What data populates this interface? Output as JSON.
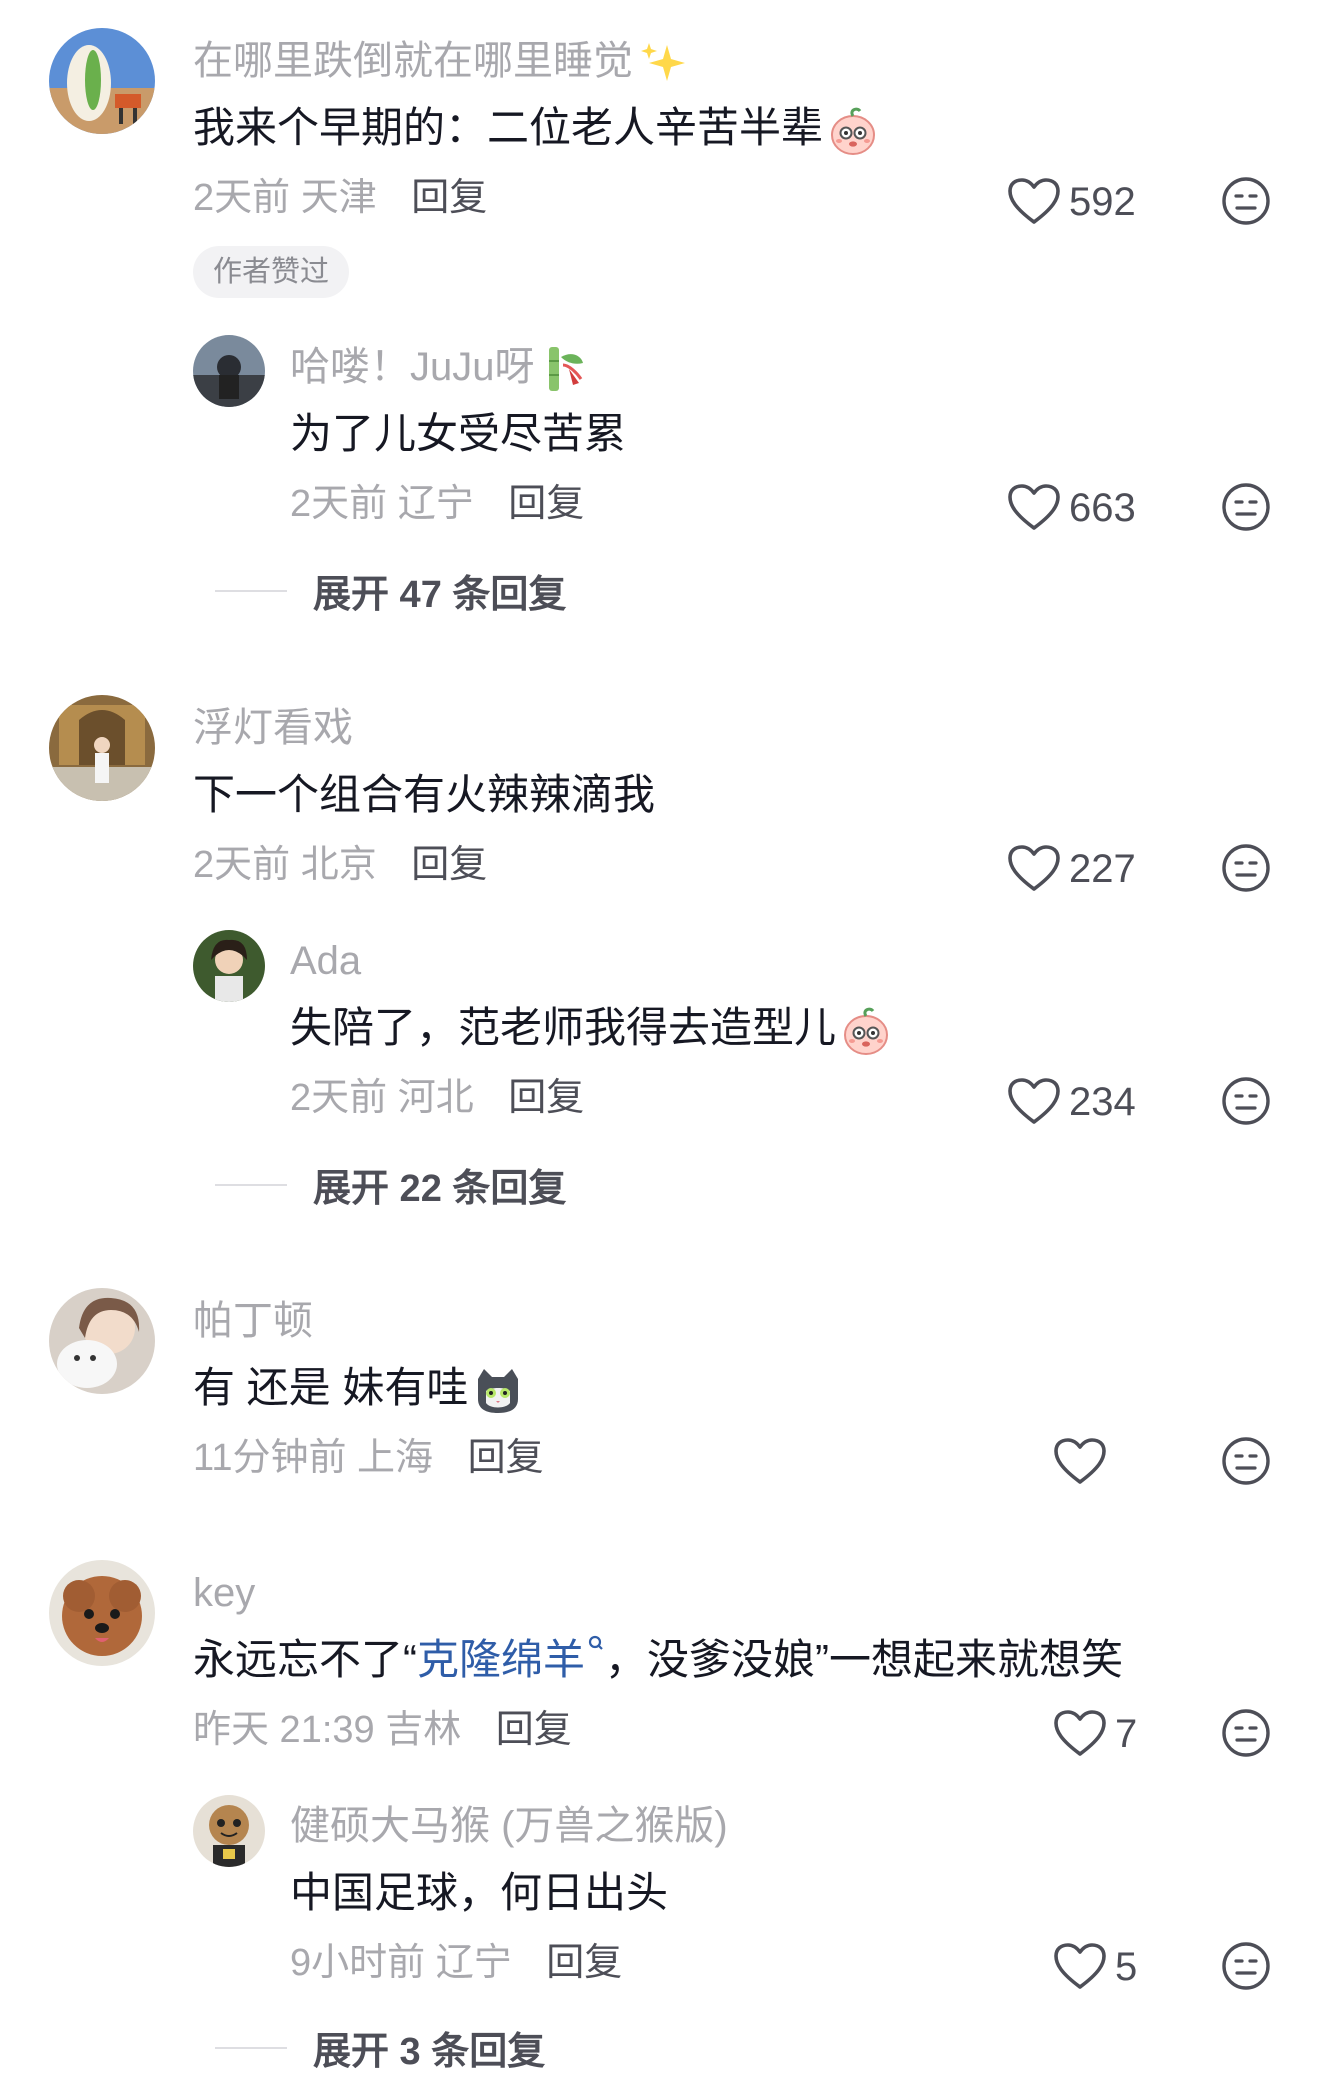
{
  "comments": [
    {
      "username": "在哪里跌倒就在哪里睡觉",
      "text": "我来个早期的：二位老人辛苦半辈",
      "time": "2天前",
      "location": "天津",
      "reply_label": "回复",
      "likes": "592",
      "badge": "作者赞过",
      "replies": [
        {
          "username": "哈喽！JuJu呀",
          "text": "为了儿女受尽苦累",
          "time": "2天前",
          "location": "辽宁",
          "reply_label": "回复",
          "likes": "663"
        }
      ],
      "expand_label": "展开 47 条回复"
    },
    {
      "username": "浮灯看戏",
      "text": "下一个组合有火辣辣滴我",
      "time": "2天前",
      "location": "北京",
      "reply_label": "回复",
      "likes": "227",
      "replies": [
        {
          "username": "Ada",
          "text": "失陪了，范老师我得去造型儿",
          "time": "2天前",
          "location": "河北",
          "reply_label": "回复",
          "likes": "234"
        }
      ],
      "expand_label": "展开 22 条回复"
    },
    {
      "username": "帕丁顿",
      "text": "有 还是 妹有哇",
      "time": "11分钟前",
      "location": "上海",
      "reply_label": "回复",
      "likes": ""
    },
    {
      "username": "key",
      "text_before": "永远忘不了“",
      "text_link": "克隆绵羊",
      "text_after": "，没爹没娘”一想起来就想笑",
      "time": "昨天 21:39",
      "location": "吉林",
      "reply_label": "回复",
      "likes": "7",
      "replies": [
        {
          "username": "健硕大马猴 (万兽之猴版)",
          "text": "中国足球，何日出头",
          "time": "9小时前",
          "location": "辽宁",
          "reply_label": "回复",
          "likes": "5"
        }
      ],
      "expand_label": "展开 3 条回复"
    }
  ],
  "icons": {
    "like": "heart-outline-icon",
    "dislike": "meh-face-icon",
    "sparkle": "sparkles-emoji",
    "peach_face": "peach-face-emoji",
    "bamboo": "bamboo-emoji",
    "cat": "cat-face-emoji",
    "search": "search-icon"
  },
  "colors": {
    "username": "#a8a8ad",
    "text": "#161823",
    "meta": "#a8a8ad",
    "reply": "#4d4e57",
    "link": "#2f5da8",
    "badge_bg": "#f2f2f4"
  }
}
